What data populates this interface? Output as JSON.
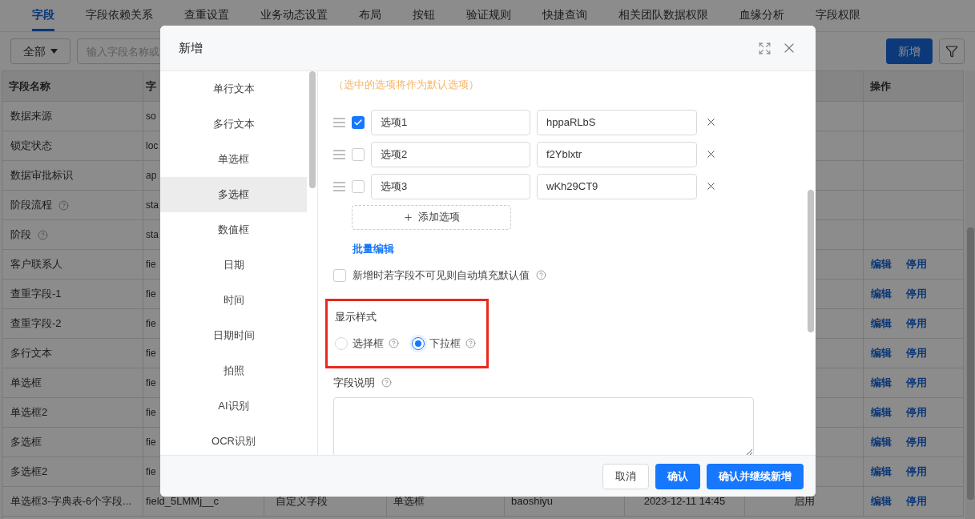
{
  "tabs": [
    {
      "label": "字段",
      "selected": true
    },
    {
      "label": "字段依赖关系",
      "selected": false
    },
    {
      "label": "查重设置",
      "selected": false
    },
    {
      "label": "业务动态设置",
      "selected": false
    },
    {
      "label": "布局",
      "selected": false
    },
    {
      "label": "按钮",
      "selected": false
    },
    {
      "label": "验证规则",
      "selected": false
    },
    {
      "label": "快捷查询",
      "selected": false
    },
    {
      "label": "相关团队数据权限",
      "selected": false
    },
    {
      "label": "血缘分析",
      "selected": false
    },
    {
      "label": "字段权限",
      "selected": false
    }
  ],
  "toolbar": {
    "filter": "全部",
    "search_placeholder": "输入字段名称或",
    "add_button": "新增"
  },
  "table": {
    "header": {
      "column_1": "字段名称",
      "column_2": "字",
      "column_8": "操作"
    },
    "rows": [
      {
        "name": "数据来源",
        "help": false,
        "column_2": "so"
      },
      {
        "name": "锁定状态",
        "help": false,
        "column_2": "loc"
      },
      {
        "name": "数据审批标识",
        "help": false,
        "column_2": "ap"
      },
      {
        "name": "阶段流程",
        "help": true,
        "column_2": "sta"
      },
      {
        "name": "阶段",
        "help": true,
        "column_2": "sta"
      },
      {
        "name": "客户联系人",
        "help": false,
        "column_2": "fie",
        "actions": [
          "编辑",
          "停用"
        ]
      },
      {
        "name": "查重字段-1",
        "help": false,
        "column_2": "fie",
        "actions": [
          "编辑",
          "停用"
        ]
      },
      {
        "name": "查重字段-2",
        "help": false,
        "column_2": "fie",
        "actions": [
          "编辑",
          "停用"
        ]
      },
      {
        "name": "多行文本",
        "help": false,
        "column_2": "fie",
        "actions": [
          "编辑",
          "停用"
        ]
      },
      {
        "name": "单选框",
        "help": false,
        "column_2": "fie",
        "actions": [
          "编辑",
          "停用"
        ]
      },
      {
        "name": "单选框2",
        "help": false,
        "column_2": "fie",
        "actions": [
          "编辑",
          "停用"
        ]
      },
      {
        "name": "多选框",
        "help": false,
        "column_2": "fie",
        "actions": [
          "编辑",
          "停用"
        ]
      },
      {
        "name": "多选框2",
        "help": false,
        "column_2": "fie",
        "actions": [
          "编辑",
          "停用"
        ]
      },
      {
        "name": "单选框3-字典表-6个字段...",
        "help": false,
        "column_2": "field_5LMMj__c",
        "column_3": "自定义字段",
        "column_4": "单选框",
        "column_5": "baoshiyu",
        "column_6": "2023-12-11 14:45",
        "column_7": "启用",
        "actions": [
          "编辑",
          "停用"
        ]
      }
    ]
  },
  "dialog": {
    "title": "新增",
    "field_types": [
      {
        "label": "单行文本",
        "selected": false
      },
      {
        "label": "多行文本",
        "selected": false
      },
      {
        "label": "单选框",
        "selected": false
      },
      {
        "label": "多选框",
        "selected": true
      },
      {
        "label": "数值框",
        "selected": false
      },
      {
        "label": "日期",
        "selected": false
      },
      {
        "label": "时间",
        "selected": false
      },
      {
        "label": "日期时间",
        "selected": false
      },
      {
        "label": "拍照",
        "selected": false
      },
      {
        "label": "AI识别",
        "selected": false
      },
      {
        "label": "OCR识别",
        "selected": false
      }
    ],
    "hint": "（选中的选项将作为默认选项）",
    "options": [
      {
        "checked": true,
        "label": "选项1",
        "value": "hppaRLbS"
      },
      {
        "checked": false,
        "label": "选项2",
        "value": "f2Yblxtr"
      },
      {
        "checked": false,
        "label": "选项3",
        "value": "wKh29CT9"
      }
    ],
    "add_option": "添加选项",
    "bulk_edit": "批量编辑",
    "autofill": {
      "label": "新增时若字段不可见则自动填充默认值",
      "checked": false
    },
    "display_style": {
      "label": "显示样式",
      "highlighted": true,
      "choices": [
        {
          "label": "选择框",
          "selected": false
        },
        {
          "label": "下拉框",
          "selected": true
        }
      ]
    },
    "description": {
      "label": "字段说明"
    },
    "buttons": [
      {
        "label": "取消",
        "kind": "secondary"
      },
      {
        "label": "确认",
        "kind": "primary"
      },
      {
        "label": "确认并继续新增",
        "kind": "primary"
      }
    ]
  }
}
